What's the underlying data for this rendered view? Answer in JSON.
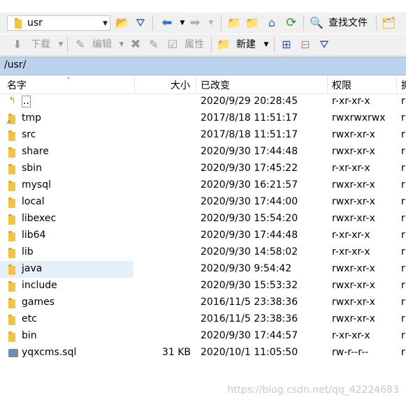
{
  "toolbar1": {
    "path_value": "usr",
    "find_files_label": "查找文件"
  },
  "toolbar2": {
    "download_label": "下载",
    "edit_label": "编辑",
    "properties_label": "属性",
    "new_label": "新建"
  },
  "path_bar": "/usr/",
  "columns": {
    "name": "名字",
    "size": "大小",
    "modified": "已改变",
    "rights": "权限",
    "owner": "拥"
  },
  "files": [
    {
      "name": "..",
      "size": "",
      "modified": "2020/9/29 20:28:45",
      "rights": "r-xr-xr-x",
      "owner": "r",
      "type": "parent"
    },
    {
      "name": "tmp",
      "size": "",
      "modified": "2017/8/18 11:51:17",
      "rights": "rwxrwxrwx",
      "owner": "r",
      "type": "link"
    },
    {
      "name": "src",
      "size": "",
      "modified": "2017/8/18 11:51:17",
      "rights": "rwxr-xr-x",
      "owner": "r",
      "type": "folder"
    },
    {
      "name": "share",
      "size": "",
      "modified": "2020/9/30 17:44:48",
      "rights": "rwxr-xr-x",
      "owner": "r",
      "type": "folder"
    },
    {
      "name": "sbin",
      "size": "",
      "modified": "2020/9/30 17:45:22",
      "rights": "r-xr-xr-x",
      "owner": "r",
      "type": "folder"
    },
    {
      "name": "mysql",
      "size": "",
      "modified": "2020/9/30 16:21:57",
      "rights": "rwxr-xr-x",
      "owner": "r",
      "type": "folder"
    },
    {
      "name": "local",
      "size": "",
      "modified": "2020/9/30 17:44:00",
      "rights": "rwxr-xr-x",
      "owner": "r",
      "type": "folder"
    },
    {
      "name": "libexec",
      "size": "",
      "modified": "2020/9/30 15:54:20",
      "rights": "rwxr-xr-x",
      "owner": "r",
      "type": "folder"
    },
    {
      "name": "lib64",
      "size": "",
      "modified": "2020/9/30 17:44:48",
      "rights": "r-xr-xr-x",
      "owner": "r",
      "type": "folder"
    },
    {
      "name": "lib",
      "size": "",
      "modified": "2020/9/30 14:58:02",
      "rights": "r-xr-xr-x",
      "owner": "r",
      "type": "folder"
    },
    {
      "name": "java",
      "size": "",
      "modified": "2020/9/30 9:54:42",
      "rights": "rwxr-xr-x",
      "owner": "r",
      "type": "folder",
      "selected": true
    },
    {
      "name": "include",
      "size": "",
      "modified": "2020/9/30 15:53:32",
      "rights": "rwxr-xr-x",
      "owner": "r",
      "type": "folder"
    },
    {
      "name": "games",
      "size": "",
      "modified": "2016/11/5 23:38:36",
      "rights": "rwxr-xr-x",
      "owner": "r",
      "type": "folder"
    },
    {
      "name": "etc",
      "size": "",
      "modified": "2016/11/5 23:38:36",
      "rights": "rwxr-xr-x",
      "owner": "r",
      "type": "folder"
    },
    {
      "name": "bin",
      "size": "",
      "modified": "2020/9/30 17:44:57",
      "rights": "r-xr-xr-x",
      "owner": "r",
      "type": "folder"
    },
    {
      "name": "yqxcms.sql",
      "size": "31 KB",
      "modified": "2020/10/1 11:05:50",
      "rights": "rw-r--r--",
      "owner": "r",
      "type": "file"
    }
  ],
  "watermark": "https://blog.csdn.net/qq_42224683"
}
